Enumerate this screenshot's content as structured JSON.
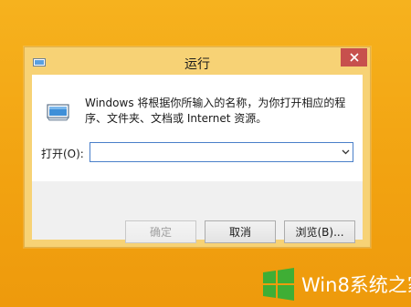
{
  "window": {
    "title": "运行",
    "close_icon": "close-icon"
  },
  "dialog": {
    "description": "Windows 将根据你所输入的名称，为你打开相应的程序、文件夹、文档或 Internet 资源。",
    "open_label": "打开(O):",
    "open_value": "",
    "buttons": {
      "ok": "确定",
      "cancel": "取消",
      "browse": "浏览(B)..."
    }
  },
  "watermark": {
    "text": "Win8系统之家"
  },
  "colors": {
    "desktop": "#f2a311",
    "window_frame": "#f7d275",
    "close_button": "#c7504d",
    "watermark_logo": "#3fae35"
  }
}
